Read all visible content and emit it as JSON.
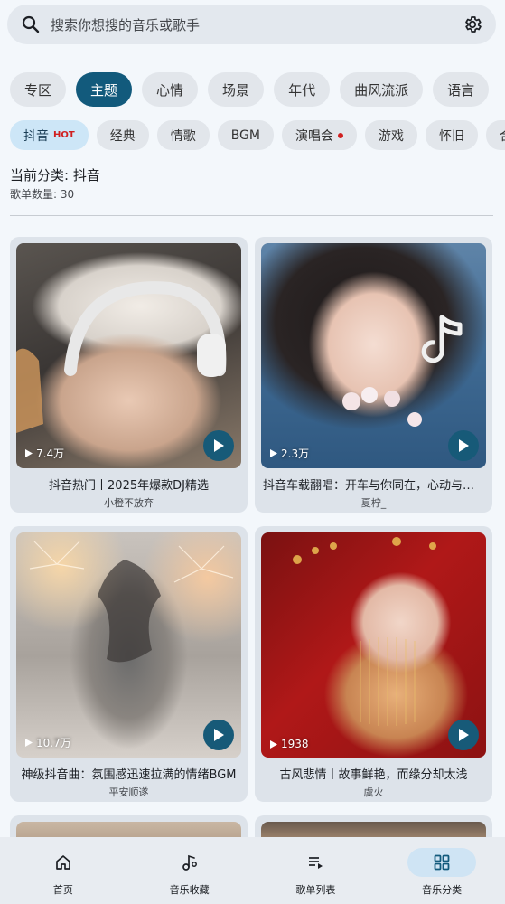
{
  "search": {
    "placeholder": "搜索你想搜的音乐或歌手",
    "search_icon": "search-icon",
    "settings_icon": "gear-icon"
  },
  "primary_tabs": [
    {
      "label": "专区",
      "active": false
    },
    {
      "label": "主题",
      "active": true
    },
    {
      "label": "心情",
      "active": false
    },
    {
      "label": "场景",
      "active": false
    },
    {
      "label": "年代",
      "active": false
    },
    {
      "label": "曲风流派",
      "active": false
    },
    {
      "label": "语言",
      "active": false
    }
  ],
  "sub_tabs": [
    {
      "label": "抖音",
      "badge": "HOT",
      "active": true
    },
    {
      "label": "经典"
    },
    {
      "label": "情歌"
    },
    {
      "label": "BGM"
    },
    {
      "label": "演唱会",
      "dot": true
    },
    {
      "label": "游戏"
    },
    {
      "label": "怀旧"
    },
    {
      "label": "合"
    }
  ],
  "category": {
    "title": "当前分类: 抖音",
    "count": "歌单数量: 30"
  },
  "playlists": [
    {
      "title": "抖音热门丨2025年爆款DJ精选",
      "author": "小橙不放弃",
      "plays": "7.4万"
    },
    {
      "title": "抖音车载翻唱：开车与你同在，心动与你相伴",
      "author": "夏柠_",
      "plays": "2.3万"
    },
    {
      "title": "神级抖音曲：氛围感迅速拉满的情绪BGM",
      "author": "平安顺遂",
      "plays": "10.7万"
    },
    {
      "title": "古风悲情丨故事鲜艳，而缘分却太浅",
      "author": "虞火",
      "plays": "1938"
    }
  ],
  "nav": [
    {
      "label": "首页",
      "icon": "home-icon",
      "active": false
    },
    {
      "label": "音乐收藏",
      "icon": "music-note-icon",
      "active": false
    },
    {
      "label": "歌单列表",
      "icon": "playlist-icon",
      "active": false
    },
    {
      "label": "音乐分类",
      "icon": "grid-icon",
      "active": true
    }
  ],
  "colors": {
    "accent": "#125a7c",
    "background": "#f3f7fb",
    "hot": "#d02020"
  }
}
